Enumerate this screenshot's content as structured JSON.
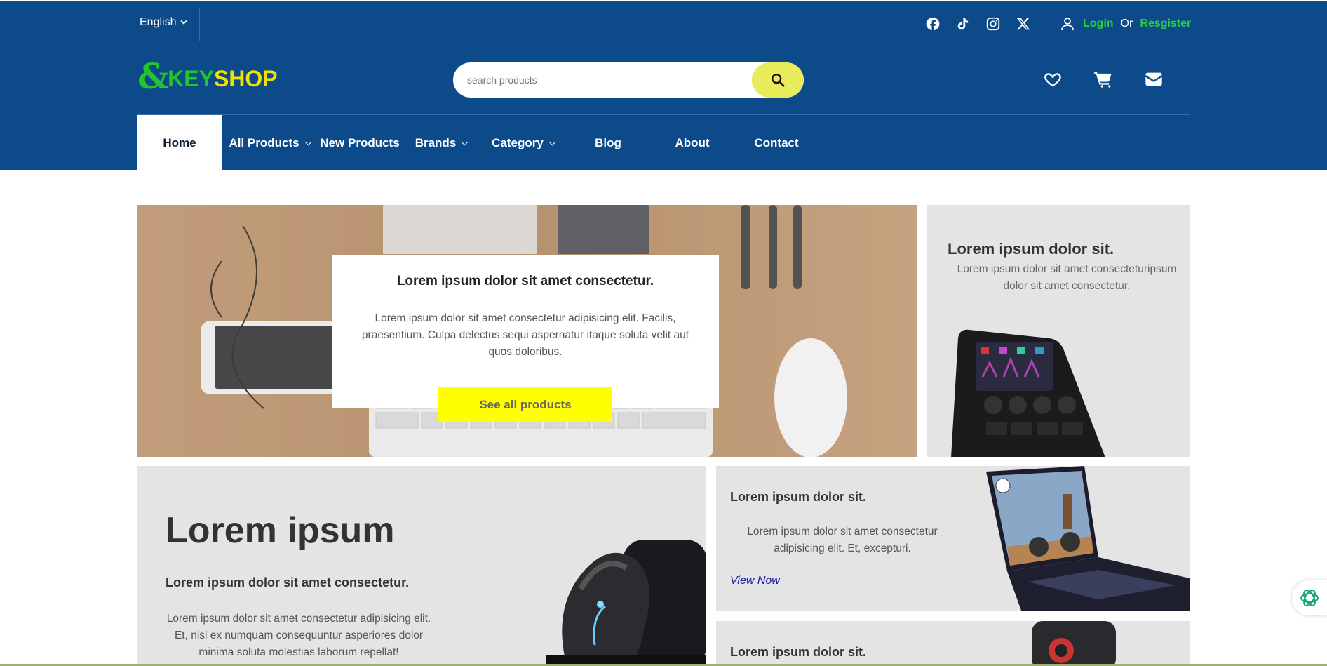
{
  "topbar": {
    "language": "English",
    "social": [
      "facebook-icon",
      "tiktok-icon",
      "instagram-icon",
      "x-icon"
    ],
    "login_label": "Login",
    "or_label": "Or",
    "register_label": "Resgister"
  },
  "logo": {
    "amp": "&",
    "key": "KEY",
    "shop": "SHOP"
  },
  "search": {
    "placeholder": "search products"
  },
  "header_icons": [
    "heart-icon",
    "cart-icon",
    "mail-icon"
  ],
  "nav": {
    "items": [
      {
        "label": "Home"
      },
      {
        "label": "All Products"
      },
      {
        "label": "New Products"
      },
      {
        "label": "Brands"
      },
      {
        "label": "Category"
      },
      {
        "label": "Blog"
      },
      {
        "label": "About"
      },
      {
        "label": "Contact"
      }
    ]
  },
  "hero": {
    "title": "Lorem ipsum dolor sit amet consectetur.",
    "text": "Lorem ipsum dolor sit amet consectetur adipisicing elit. Facilis, praesentium. Culpa delectus sequi aspernatur itaque soluta velit aut quos doloribus.",
    "button": "See all products"
  },
  "side_card": {
    "title": "Lorem ipsum dolor sit.",
    "text": "Lorem ipsum dolor sit amet consecteturipsum dolor sit amet consectetur."
  },
  "promo": {
    "heading": "Lorem ipsum",
    "subheading": "Lorem ipsum dolor sit amet consectetur.",
    "text": "Lorem ipsum dolor sit amet consectetur adipisicing elit. Et, nisi ex numquam consequuntur asperiores dolor minima soluta molestias laborum repellat!"
  },
  "card_laptop": {
    "title": "Lorem ipsum dolor sit.",
    "text": "Lorem ipsum dolor sit amet consectetur adipisicing elit. Et, excepturi.",
    "link": "View Now"
  },
  "card_bottom": {
    "title": "Lorem ipsum dolor sit."
  },
  "colors": {
    "header": "#0c4a8a",
    "accent_green": "#22d13a",
    "accent_yellow": "#ffff00"
  }
}
